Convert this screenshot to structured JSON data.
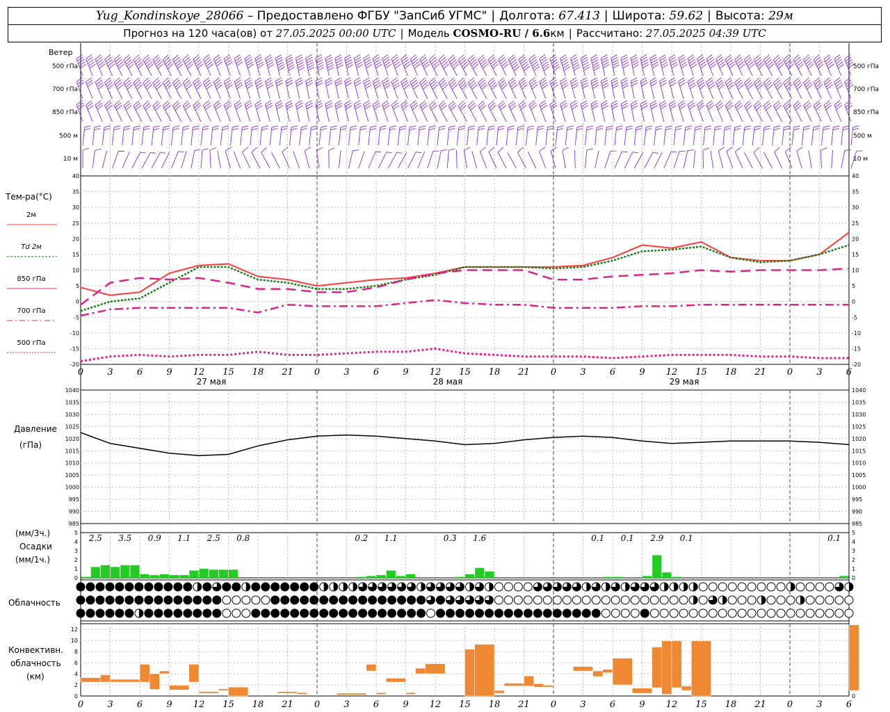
{
  "header": {
    "station": "Yug_Kondinskoye_28066",
    "provider": "– Предоставлено ФГБУ \"ЗапСиб УГМС\"",
    "lon_label": "Долгота:",
    "lon_value": "67.413",
    "lat_label": "Широта:",
    "lat_value": "59.62",
    "alt_label": "Высота:",
    "alt_value": "29м",
    "forecast_label": "Прогноз на 120 часа(ов)  от",
    "forecast_start": "27.05.2025 00:00 UTC",
    "model_label": "Модель",
    "model_value": "COSMO-RU / 6.6",
    "model_unit": "км",
    "calc_label": "Рассчитано:",
    "calc_value": "27.05.2025 04:39 UTC"
  },
  "labels": {
    "wind_title": "Ветер",
    "wind_levels": [
      "500 гПа",
      "700 гПа",
      "850 гПа",
      "500  м",
      "10  м"
    ],
    "temp_title": "Тем-ра(°C)",
    "temp_legend": [
      "2м",
      "Td  2м",
      "850 гПа",
      "700 гПа",
      "500 гПа"
    ],
    "pressure_title": "Давление",
    "pressure_unit": "(гПа)",
    "precip_unit_top": "(мм/3ч.)",
    "precip_title": "Осадки",
    "precip_unit": "(мм/1ч.)",
    "cloud_title": "Облачность",
    "conv_title": [
      "Конвективн.",
      "облачность",
      "(км)"
    ],
    "dates": [
      "27 мая",
      "28 мая",
      "29 мая"
    ],
    "hour_ticks": [
      "0",
      "3",
      "6",
      "9",
      "12",
      "15",
      "18",
      "21",
      "0",
      "3",
      "6",
      "9",
      "12",
      "15",
      "18",
      "21",
      "0",
      "3",
      "6",
      "9",
      "12",
      "15",
      "18",
      "21",
      "0",
      "3",
      "6"
    ]
  },
  "colors": {
    "wind": "#8a2be2",
    "t2m": "#ff3b3b",
    "td2m": "#1a7a1a",
    "t850": "#e0208c",
    "t700": "#e0208c",
    "t500": "#e0208c",
    "pressure": "#000000",
    "precip": "#22cc22",
    "conv": "#ee8833"
  },
  "chart_data": [
    {
      "type": "line",
      "name": "temperature",
      "x_hours": [
        0,
        3,
        6,
        9,
        12,
        15,
        18,
        21,
        24,
        27,
        30,
        33,
        36,
        39,
        42,
        45,
        48,
        51,
        54,
        57,
        60,
        63,
        66,
        69,
        72,
        75,
        78
      ],
      "series": [
        {
          "name": "2м",
          "values": [
            4.5,
            2,
            3,
            9,
            11.5,
            12,
            8,
            7,
            5,
            6,
            7,
            7.5,
            9,
            11,
            11,
            11,
            11,
            11.5,
            14,
            18,
            17,
            19,
            14,
            13,
            13,
            15,
            22
          ]
        },
        {
          "name": "Td  2м",
          "values": [
            -3,
            0,
            1,
            6,
            11,
            11,
            7,
            6,
            4,
            4,
            5,
            7,
            8.5,
            11,
            11,
            11,
            10.5,
            11,
            13,
            16,
            16.5,
            17.5,
            14,
            12.5,
            13,
            15,
            18
          ]
        },
        {
          "name": "850 гПа",
          "values": [
            -1,
            6,
            7.5,
            7,
            7.5,
            6,
            4,
            4,
            3,
            3,
            4.5,
            7,
            9,
            10,
            10,
            10,
            7,
            7,
            8,
            8.5,
            9,
            10,
            9.5,
            10,
            10,
            10,
            10.5
          ]
        },
        {
          "name": "700 гПа",
          "values": [
            -4.5,
            -2.5,
            -2,
            -2,
            -2,
            -2,
            -3.5,
            -1,
            -1.5,
            -1.5,
            -1.5,
            -0.5,
            0.5,
            -0.5,
            -1,
            -1,
            -2,
            -2,
            -2,
            -1.5,
            -1.5,
            -1,
            -1,
            -1,
            -1,
            -1,
            -1
          ]
        },
        {
          "name": "500 гПа",
          "values": [
            -19,
            -17.5,
            -17,
            -17.5,
            -17,
            -17,
            -16,
            -17,
            -17,
            -16.5,
            -16,
            -16,
            -15,
            -16.5,
            -17,
            -17.5,
            -17.5,
            -17.5,
            -18,
            -17.5,
            -17,
            -17,
            -17,
            -17.5,
            -17.5,
            -18,
            -18
          ]
        }
      ],
      "ylim": [
        -20,
        40
      ]
    },
    {
      "type": "line",
      "name": "pressure",
      "x_hours": [
        0,
        3,
        6,
        9,
        12,
        15,
        18,
        21,
        24,
        27,
        30,
        33,
        36,
        39,
        42,
        45,
        48,
        51,
        54,
        57,
        60,
        63,
        66,
        69,
        72,
        75,
        78
      ],
      "series": [
        {
          "name": "Давление",
          "values": [
            1022.5,
            1018,
            1016,
            1014,
            1013,
            1013.5,
            1017,
            1019.5,
            1021,
            1021.5,
            1021,
            1020,
            1019,
            1017.5,
            1018,
            1019.5,
            1020.5,
            1021,
            1020.5,
            1019,
            1018,
            1018.5,
            1019,
            1019,
            1019,
            1018.5,
            1017.5
          ]
        }
      ],
      "ylim": [
        985,
        1040
      ]
    },
    {
      "type": "bar",
      "name": "precipitation",
      "ylim": [
        0,
        5
      ],
      "hourly": [
        {
          "h": 0,
          "v": 0.1
        },
        {
          "h": 1,
          "v": 1.2
        },
        {
          "h": 2,
          "v": 1.4
        },
        {
          "h": 3,
          "v": 1.2
        },
        {
          "h": 4,
          "v": 1.4
        },
        {
          "h": 5,
          "v": 1.4
        },
        {
          "h": 6,
          "v": 0.4
        },
        {
          "h": 7,
          "v": 0.3
        },
        {
          "h": 8,
          "v": 0.4
        },
        {
          "h": 9,
          "v": 0.3
        },
        {
          "h": 10,
          "v": 0.3
        },
        {
          "h": 11,
          "v": 0.8
        },
        {
          "h": 12,
          "v": 1.0
        },
        {
          "h": 13,
          "v": 0.9
        },
        {
          "h": 14,
          "v": 0.9
        },
        {
          "h": 15,
          "v": 0.9
        },
        {
          "h": 28,
          "v": 0.1
        },
        {
          "h": 29,
          "v": 0.2
        },
        {
          "h": 30,
          "v": 0.3
        },
        {
          "h": 31,
          "v": 0.8
        },
        {
          "h": 32,
          "v": 0.2
        },
        {
          "h": 33,
          "v": 0.4
        },
        {
          "h": 38,
          "v": 0.1
        },
        {
          "h": 39,
          "v": 0.4
        },
        {
          "h": 40,
          "v": 1.1
        },
        {
          "h": 41,
          "v": 0.7
        },
        {
          "h": 53,
          "v": 0.1
        },
        {
          "h": 54,
          "v": 0.1
        },
        {
          "h": 57,
          "v": 0.2
        },
        {
          "h": 58,
          "v": 2.5
        },
        {
          "h": 59,
          "v": 0.6
        },
        {
          "h": 60,
          "v": 0.1
        },
        {
          "h": 77,
          "v": 0.2
        }
      ],
      "three_hour_labels": [
        {
          "h": 1.5,
          "t": "2.5"
        },
        {
          "h": 4.5,
          "t": "3.5"
        },
        {
          "h": 7.5,
          "t": "0.9"
        },
        {
          "h": 10.5,
          "t": "1.1"
        },
        {
          "h": 13.5,
          "t": "2.5"
        },
        {
          "h": 16.5,
          "t": "0.8"
        },
        {
          "h": 28.5,
          "t": "0.2"
        },
        {
          "h": 31.5,
          "t": "1.1"
        },
        {
          "h": 37.5,
          "t": "0.3"
        },
        {
          "h": 40.5,
          "t": "1.6"
        },
        {
          "h": 52.5,
          "t": "0.1"
        },
        {
          "h": 55.5,
          "t": "0.1"
        },
        {
          "h": 58.5,
          "t": "2.9"
        },
        {
          "h": 61.5,
          "t": "0.1"
        },
        {
          "h": 76.5,
          "t": "0.1"
        }
      ]
    },
    {
      "type": "table",
      "name": "cloudiness",
      "rows": [
        "FFFFFFFFFFFFHFTFFHFFFFFFFHHHHTTTTTTHTTTTHTHOOOOTTTTTHTHTHTTTHHHHOOOOOOOOOHOOOOTH",
        "FFFFFFFFFFFFFFFOOOOOFFFFFFFFFFFFFFFFTFTTTTTOOOOOOOOOOOOOOOOOOOOHOTHOOOHOOOHOOOOO",
        "FFFFFFHFFFFFFFFOOOFFFFFFFFFFFFFFFFFFOFFFFFFFFFFFFFFFFFOOOOFOOOOOOOOOOOOOOOOOOOOO"
      ]
    },
    {
      "type": "bar",
      "name": "convective",
      "ylim": [
        0,
        13
      ],
      "segments": [
        {
          "h0": 0,
          "h1": 2,
          "lo": 2.5,
          "hi": 3.3
        },
        {
          "h0": 2,
          "h1": 3,
          "lo": 2.5,
          "hi": 3.8
        },
        {
          "h0": 3,
          "h1": 6,
          "lo": 2.5,
          "hi": 3.0
        },
        {
          "h0": 6,
          "h1": 7,
          "lo": 2.5,
          "hi": 5.7
        },
        {
          "h0": 7,
          "h1": 8,
          "lo": 1.2,
          "hi": 4.0
        },
        {
          "h0": 8,
          "h1": 9,
          "lo": 4.0,
          "hi": 4.5
        },
        {
          "h0": 9,
          "h1": 11,
          "lo": 1.1,
          "hi": 1.9
        },
        {
          "h0": 11,
          "h1": 12,
          "lo": 2.5,
          "hi": 5.7
        },
        {
          "h0": 12,
          "h1": 14,
          "lo": 0.5,
          "hi": 0.8
        },
        {
          "h0": 14,
          "h1": 15,
          "lo": 1.0,
          "hi": 1.3
        },
        {
          "h0": 15,
          "h1": 17,
          "lo": 0.0,
          "hi": 1.6
        },
        {
          "h0": 20,
          "h1": 22,
          "lo": 0.5,
          "hi": 0.8
        },
        {
          "h0": 22,
          "h1": 23,
          "lo": 0.3,
          "hi": 0.6
        },
        {
          "h0": 26,
          "h1": 29,
          "lo": 0.2,
          "hi": 0.5
        },
        {
          "h0": 29,
          "h1": 30,
          "lo": 4.5,
          "hi": 5.7
        },
        {
          "h0": 30,
          "h1": 31,
          "lo": 0.3,
          "hi": 0.6
        },
        {
          "h0": 31,
          "h1": 33,
          "lo": 2.5,
          "hi": 3.2
        },
        {
          "h0": 33,
          "h1": 34,
          "lo": 0.3,
          "hi": 0.6
        },
        {
          "h0": 34,
          "h1": 35,
          "lo": 4.0,
          "hi": 5.0
        },
        {
          "h0": 35,
          "h1": 37,
          "lo": 4.0,
          "hi": 5.8
        },
        {
          "h0": 39,
          "h1": 40,
          "lo": 0.0,
          "hi": 8.4
        },
        {
          "h0": 40,
          "h1": 42,
          "lo": 0.0,
          "hi": 9.3
        },
        {
          "h0": 42,
          "h1": 43,
          "lo": 0.5,
          "hi": 1.0
        },
        {
          "h0": 43,
          "h1": 45,
          "lo": 1.8,
          "hi": 2.3
        },
        {
          "h0": 45,
          "h1": 46,
          "lo": 1.8,
          "hi": 3.6
        },
        {
          "h0": 46,
          "h1": 47,
          "lo": 1.6,
          "hi": 2.2
        },
        {
          "h0": 47,
          "h1": 48,
          "lo": 1.6,
          "hi": 1.9
        },
        {
          "h0": 50,
          "h1": 52,
          "lo": 4.5,
          "hi": 5.3
        },
        {
          "h0": 52,
          "h1": 53,
          "lo": 3.5,
          "hi": 4.5
        },
        {
          "h0": 53,
          "h1": 54,
          "lo": 4.2,
          "hi": 4.8
        },
        {
          "h0": 54,
          "h1": 56,
          "lo": 2.0,
          "hi": 6.8
        },
        {
          "h0": 56,
          "h1": 58,
          "lo": 0.5,
          "hi": 1.4
        },
        {
          "h0": 58,
          "h1": 59,
          "lo": 1.5,
          "hi": 8.8
        },
        {
          "h0": 59,
          "h1": 60,
          "lo": 0.3,
          "hi": 9.9
        },
        {
          "h0": 60,
          "h1": 61,
          "lo": 1.5,
          "hi": 9.9
        },
        {
          "h0": 61,
          "h1": 62,
          "lo": 1.0,
          "hi": 1.8
        },
        {
          "h0": 62,
          "h1": 64,
          "lo": 0.0,
          "hi": 9.9
        },
        {
          "h0": 78,
          "h1": 79,
          "lo": 1.0,
          "hi": 12.8
        }
      ]
    },
    {
      "type": "other",
      "name": "wind_barbs",
      "levels": [
        "500 гПа",
        "700 гПа",
        "850 гПа",
        "500  м",
        "10  м"
      ],
      "speed_barbs": [
        [
          5,
          5,
          5,
          5,
          5,
          4,
          5,
          6,
          6,
          5,
          5,
          5,
          5,
          5,
          5,
          6,
          6,
          6,
          5,
          5,
          5,
          5,
          5,
          5,
          5,
          5,
          5
        ],
        [
          3,
          4,
          4,
          4,
          4,
          4,
          4,
          3,
          3,
          3,
          4,
          4,
          4,
          4,
          4,
          4,
          4,
          4,
          4,
          3,
          3,
          4,
          4,
          4,
          4,
          4,
          4
        ],
        [
          3,
          3,
          3,
          3,
          3,
          3,
          3,
          3,
          3,
          3,
          3,
          3,
          3,
          3,
          3,
          3,
          3,
          3,
          3,
          3,
          3,
          3,
          3,
          3,
          3,
          3,
          3
        ],
        [
          2,
          2,
          2,
          2,
          2,
          2,
          2,
          2,
          2,
          2,
          2,
          2,
          2,
          2,
          2,
          2,
          2,
          2,
          2,
          2,
          2,
          2,
          2,
          2,
          2,
          2,
          2
        ],
        [
          1,
          1,
          1,
          1,
          1,
          1,
          1,
          1,
          1,
          1,
          1,
          1,
          1,
          1,
          1,
          1,
          1,
          1,
          1,
          1,
          1,
          1,
          1,
          1,
          1,
          1,
          1
        ]
      ]
    }
  ]
}
